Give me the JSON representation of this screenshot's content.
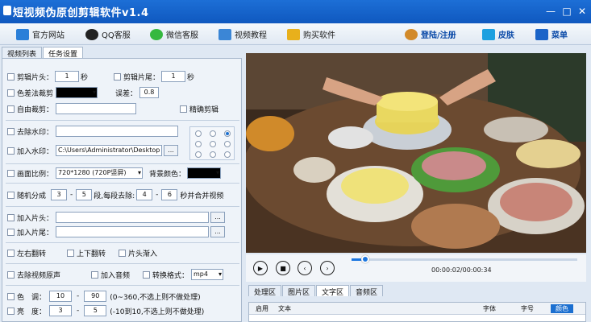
{
  "window": {
    "title": "短视频伪原创剪辑软件v1.4"
  },
  "toolbar": {
    "items": [
      {
        "label": "官方网站",
        "icon": "monitor-icon",
        "color": "#2a7fd8"
      },
      {
        "label": "QQ客服",
        "icon": "qq-penguin-icon",
        "color": "#222"
      },
      {
        "label": "微信客服",
        "icon": "wechat-icon",
        "color": "#35b83f"
      },
      {
        "label": "视频教程",
        "icon": "film-icon",
        "color": "#3b86d6"
      },
      {
        "label": "购买软件",
        "icon": "crown-icon",
        "color": "#e8b01c"
      }
    ],
    "right": [
      {
        "label": "登陆/注册",
        "icon": "user-icon",
        "color": "#d28a2a"
      },
      {
        "label": "皮肤",
        "icon": "shirt-icon",
        "color": "#1da0e0"
      },
      {
        "label": "菜单",
        "icon": "menu-grid-icon",
        "color": "#1b64c8"
      }
    ]
  },
  "tabs": [
    "视频列表",
    "任务设置"
  ],
  "settings": {
    "trim_head": {
      "label": "剪辑片头：",
      "value": "1",
      "unit": "秒"
    },
    "trim_tail": {
      "label": "剪辑片尾：",
      "value": "1",
      "unit": "秒"
    },
    "color_crop": {
      "label": "色差法裁剪",
      "error_label": "误差：",
      "error_value": "0.8"
    },
    "free_crop": {
      "label": "自由裁剪：",
      "precise_label": "精确剪辑"
    },
    "remove_watermark": {
      "label": "去除水印："
    },
    "add_watermark": {
      "label": "加入水印：",
      "path": "C:\\Users\\Administrator\\Desktop"
    },
    "aspect": {
      "label": "画面比例：",
      "value": "720*1280 (720P竖屏)",
      "bg_label": "背景颜色："
    },
    "random_split": {
      "label": "随机分成",
      "a": "3",
      "b": "5",
      "mid": "段,每段去除:",
      "c": "4",
      "d": "6",
      "tail": "秒并合并视频"
    },
    "add_head": {
      "label": "加入片头："
    },
    "add_tail": {
      "label": "加入片尾："
    },
    "flip_lr": "左右翻转",
    "flip_ud": "上下翻转",
    "fade_in": "片头渐入",
    "remove_audio": "去除视频原声",
    "add_audio": "加入音频",
    "format_label": "转换格式：",
    "format_value": "mp4",
    "hue": {
      "label": "色　调：",
      "a": "10",
      "b": "90",
      "hint": "(0~360,不选上则不做处理)"
    },
    "brightness": {
      "label": "亮　度：",
      "a": "3",
      "b": "5",
      "hint": "(-10到10,不选上则不做处理)"
    }
  },
  "player": {
    "time": "00:00:02/00:00:34",
    "progress": 0.06
  },
  "right_tabs": [
    "处理区",
    "图片区",
    "文字区",
    "音频区"
  ],
  "table": {
    "headers": [
      "启用",
      "文本",
      "字体",
      "字号",
      "颜色"
    ]
  }
}
